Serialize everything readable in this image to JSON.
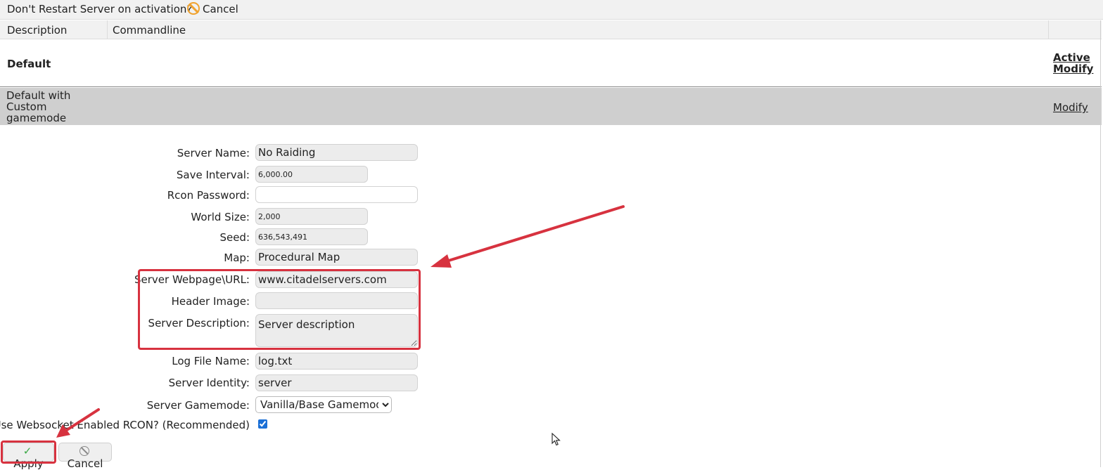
{
  "topbar": {
    "warning_text": "Don't Restart Server on activation?",
    "cancel_label": "Cancel",
    "cancel_icon": "no-entry-icon"
  },
  "table": {
    "headers": [
      "Description",
      "Commandline"
    ],
    "rows": [
      {
        "name": "Default",
        "actions": [
          "Active",
          "Modify"
        ]
      },
      {
        "name": "Default with Custom gamemode",
        "actions": [
          "Modify"
        ]
      }
    ]
  },
  "form": {
    "server_name": {
      "label": "Server Name:",
      "value": "No Raiding"
    },
    "save_interval": {
      "label": "Save Interval:",
      "value": "6,000.00"
    },
    "rcon_password": {
      "label": "Rcon Password:",
      "value": ""
    },
    "world_size": {
      "label": "World Size:",
      "value": "2,000"
    },
    "seed": {
      "label": "Seed:",
      "value": "636,543,491"
    },
    "map": {
      "label": "Map:",
      "value": "Procedural Map"
    },
    "server_url": {
      "label": "Server Webpage\\URL:",
      "value": "www.citadelservers.com"
    },
    "header_image": {
      "label": "Header Image:",
      "value": ""
    },
    "server_description": {
      "label": "Server Description:",
      "value": "Server description"
    },
    "log_file": {
      "label": "Log File Name:",
      "value": "log.txt"
    },
    "server_identity": {
      "label": "Server Identity:",
      "value": "server"
    },
    "gamemode": {
      "label": "Server Gamemode:",
      "value": "Vanilla/Base Gamemode"
    },
    "websocket_rcon": {
      "label": "Use Websocket Enabled RCON? (Recommended)",
      "checked": true
    }
  },
  "buttons": {
    "apply_label": "Apply",
    "cancel_label": "Cancel"
  },
  "colors": {
    "annotation": "#d7323f",
    "warning_icon": "#f0a22e",
    "selected_row": "#cfcfcf"
  }
}
